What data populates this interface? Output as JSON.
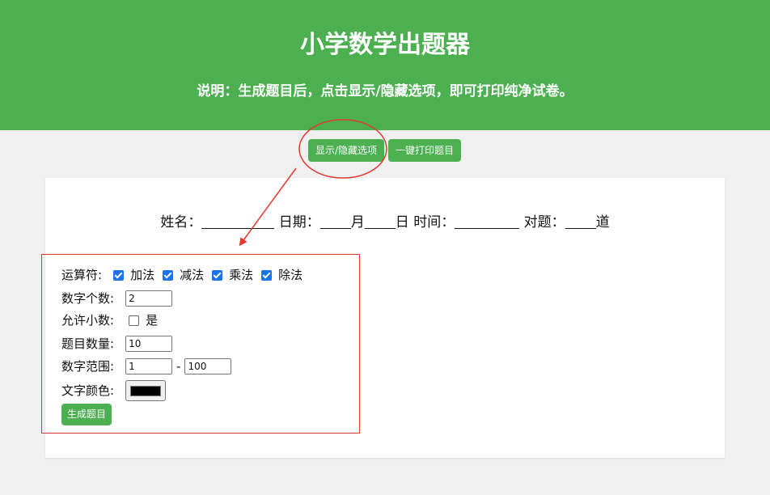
{
  "header": {
    "title": "小学数学出题器",
    "description": "说明：生成题目后，点击显示/隐藏选项，即可打印纯净试卷。"
  },
  "toolbar": {
    "toggle_label": "显示/隐藏选项",
    "print_label": "一键打印题目"
  },
  "sheet": {
    "name_label": "姓名：",
    "date_label": "日期：",
    "month_suffix": "月",
    "day_suffix": "日",
    "time_label": "时间：",
    "correct_label": "对题：",
    "correct_suffix": "道"
  },
  "options": {
    "operators_label": "运算符:",
    "operators": [
      {
        "label": "加法",
        "checked": true
      },
      {
        "label": "减法",
        "checked": true
      },
      {
        "label": "乘法",
        "checked": true
      },
      {
        "label": "除法",
        "checked": true
      }
    ],
    "number_count_label": "数字个数:",
    "number_count_value": "2",
    "allow_decimal_label": "允许小数:",
    "allow_decimal_option": "是",
    "allow_decimal_checked": false,
    "question_count_label": "题目数量:",
    "question_count_value": "10",
    "range_label": "数字范围:",
    "range_min": "1",
    "range_separator": "-",
    "range_max": "100",
    "text_color_label": "文字颜色:",
    "text_color_value": "#000000",
    "generate_label": "生成题目"
  },
  "colors": {
    "accent": "#4caf50",
    "annotation": "#e03a2f",
    "checkbox": "#1a73e8"
  }
}
